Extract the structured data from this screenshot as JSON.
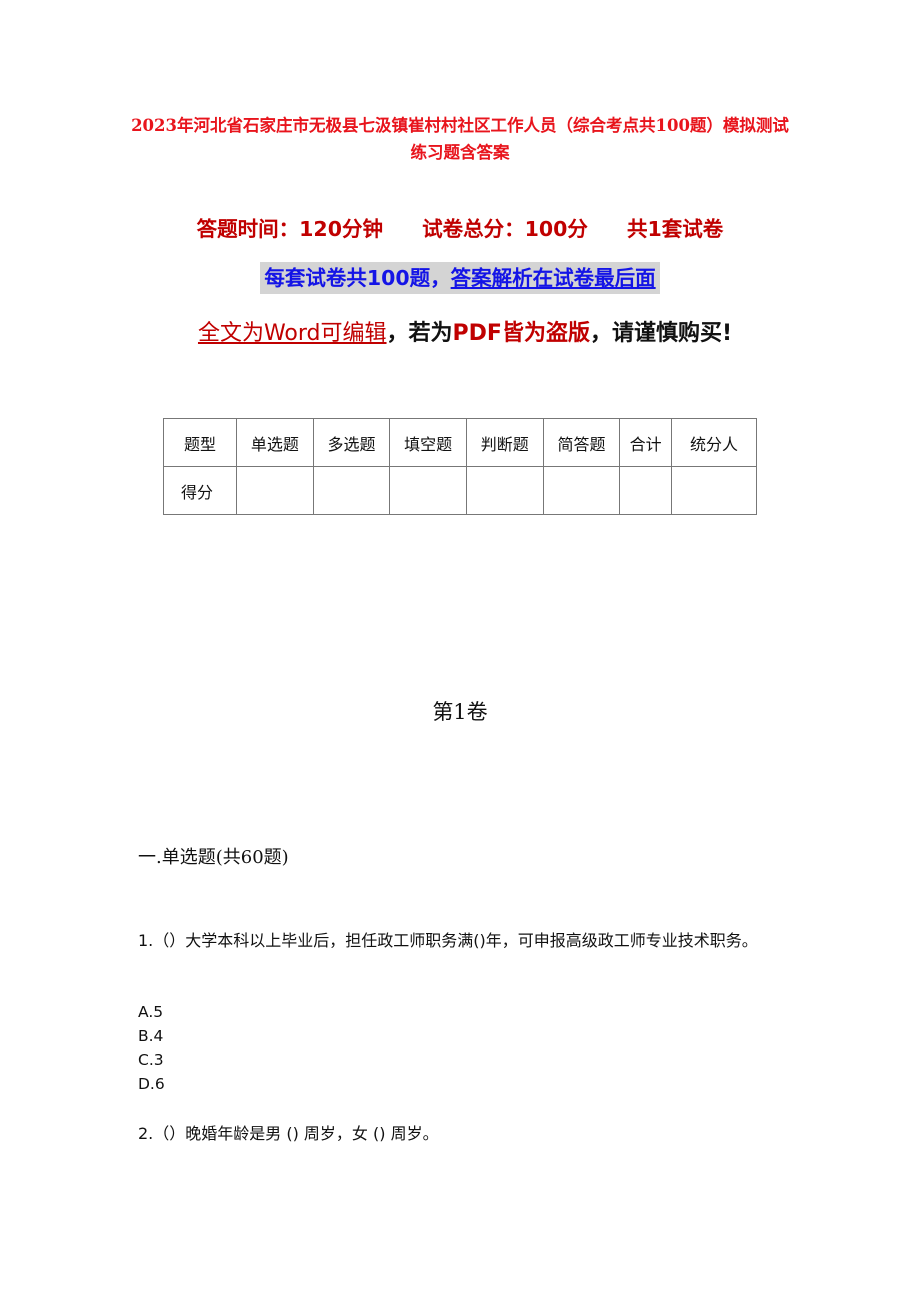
{
  "document": {
    "title": "2023年河北省石家庄市无极县七汲镇崔村村社区工作人员（综合考点共100题）模拟测试练习题含答案",
    "meta": {
      "time": "答题时间：120分钟",
      "total_score": "试卷总分：100分",
      "sets": "共1套试卷"
    },
    "notice": {
      "part1": "每套试卷共100题，",
      "part2": "答案解析在试卷最后面"
    },
    "warning": {
      "part1": "全文为Word可编辑",
      "sep1": "，若为",
      "part2": "PDF皆为盗版",
      "part3": "，请谨慎购买!"
    },
    "colors": {
      "title_red": "#e8141c",
      "meta_red": "#c00000",
      "notice_blue": "#1414e6",
      "notice_bg": "#d4d4d4"
    },
    "score_table": {
      "headers": [
        "题型",
        "单选题",
        "多选题",
        "填空题",
        "判断题",
        "简答题",
        "合计",
        "统分人"
      ],
      "row_label": "得分",
      "row_values": [
        "",
        "",
        "",
        "",
        "",
        "",
        ""
      ]
    },
    "volume": "第1卷",
    "section": "一.单选题(共60题)",
    "questions": [
      {
        "text": "1.（）大学本科以上毕业后，担任政工师职务满()年，可申报高级政工师专业技术职务。",
        "options": [
          "A.5",
          "B.4",
          "C.3",
          "D.6"
        ]
      },
      {
        "text": "2.（）晚婚年龄是男 () 周岁，女 () 周岁。",
        "options": []
      }
    ]
  }
}
